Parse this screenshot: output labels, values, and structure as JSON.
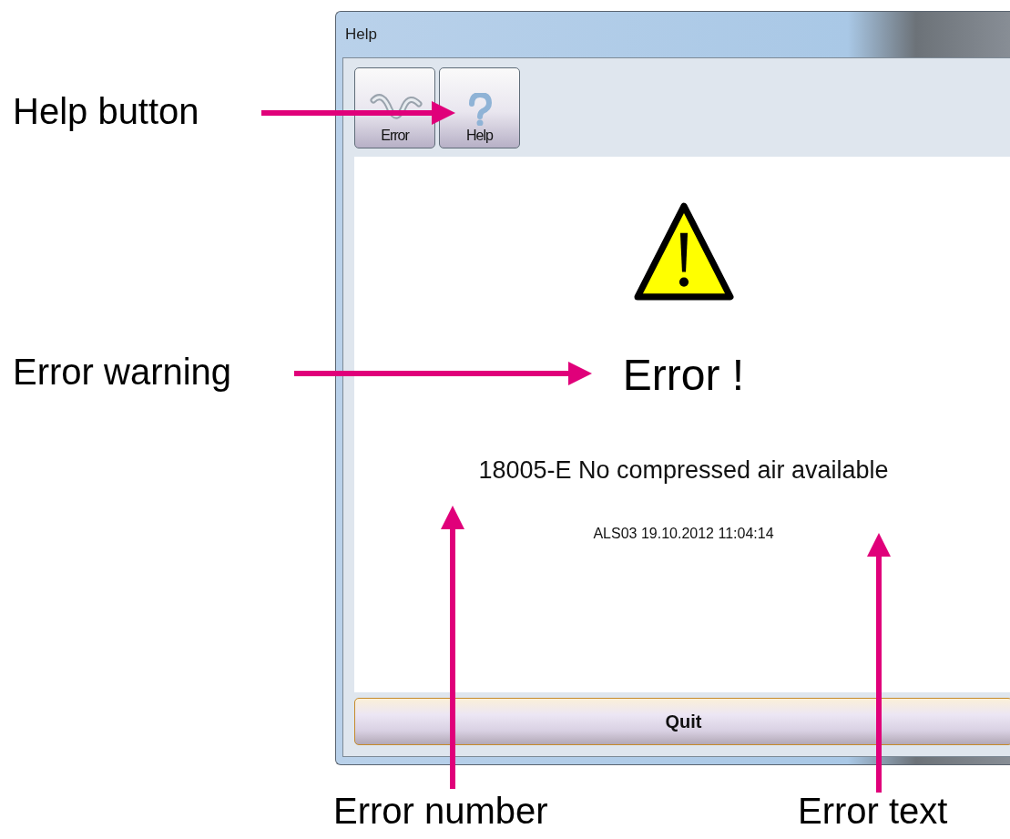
{
  "window": {
    "title": "Help"
  },
  "toolbar": [
    {
      "label": "Error",
      "kind": "error"
    },
    {
      "label": "Help",
      "kind": "help"
    }
  ],
  "alert": {
    "heading": "Error !",
    "message": "18005-E No compressed air available",
    "detail": "ALS03 19.10.2012 11:04:14"
  },
  "quit_button": "Quit",
  "annotations": [
    {
      "label": "Help button"
    },
    {
      "label": "Error warning"
    },
    {
      "label": "Error number"
    },
    {
      "label": "Error text"
    }
  ]
}
